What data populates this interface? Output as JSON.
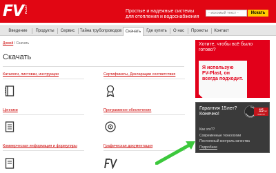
{
  "header": {
    "logo_text": "FV",
    "logo_sub": "PLAST",
    "tagline": "Простые и надежные системы для отопления и водоснабжения",
    "search_placeholder": "- искомый текст -",
    "search_button": "Искать",
    "accent_color": "#e10613"
  },
  "nav": {
    "items": [
      {
        "label": "Введение"
      },
      {
        "label": "Продукты"
      },
      {
        "label": "Сервис"
      },
      {
        "label": "Тайна трубопроводов"
      },
      {
        "label": "Скачать",
        "active": true
      },
      {
        "label": "Где купить"
      },
      {
        "label": "О нас"
      },
      {
        "label": "Проекты"
      },
      {
        "label": "Контакт"
      }
    ]
  },
  "breadcrumb": {
    "home": "Домой",
    "separator": "/",
    "current": "Скачать"
  },
  "page_title": "Скачать",
  "sections": [
    {
      "label": "Каталоги, листовки, инструкции",
      "icon": "book-icon"
    },
    {
      "label": "Сертификаты, Декларации соответствия",
      "icon": "award-ribbon-icon"
    },
    {
      "label": "Ценники",
      "icon": "price-list-icon"
    },
    {
      "label": "Программное обеспечение",
      "icon": "cd-disc-icon"
    },
    {
      "label": "Коммерческая информация и формуляры",
      "icon": "document-icon"
    },
    {
      "label": "Графическая документация",
      "icon": "fv-logo-icon"
    }
  ],
  "promo": {
    "question": "Хотите, чтобы всё было готово?",
    "answer_lines": [
      "Я использую",
      "FV-Plast, он",
      "всегда подходит."
    ]
  },
  "guarantee": {
    "title": "Гарантия 15лет? Конечно!",
    "badge_top": "15",
    "badge_unit": "лет",
    "badge_bottom": "гарантия",
    "question": "Как это??",
    "line1": "Современные технологии",
    "line2": "Постоянный контроль качества",
    "more_link": "Подробнее"
  },
  "annotation": {
    "arrow_color": "#3cc83c"
  }
}
